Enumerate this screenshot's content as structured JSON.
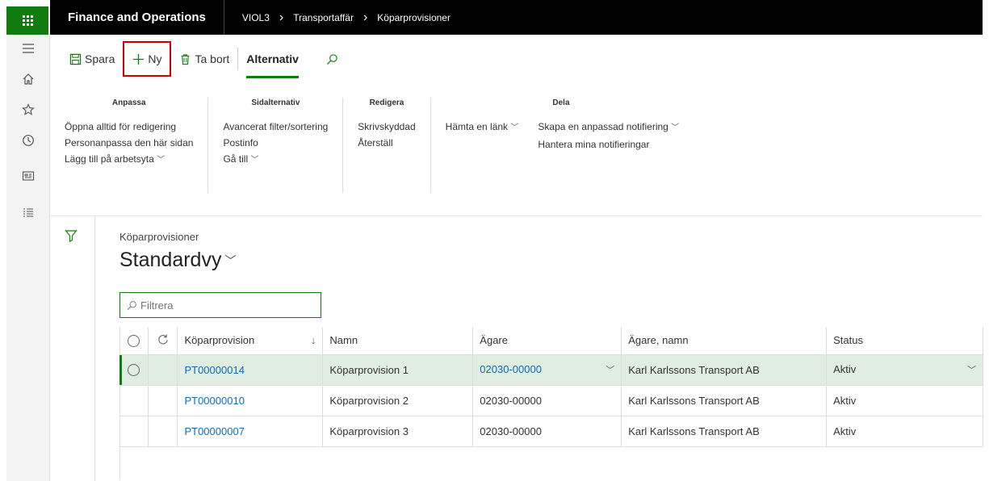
{
  "header": {
    "app_title": "Finance and Operations",
    "breadcrumbs": [
      "VIOL3",
      "Transportaffär",
      "Köparprovisioner"
    ]
  },
  "toolbar": {
    "save_label": "Spara",
    "new_label": "Ny",
    "delete_label": "Ta bort",
    "options_tab": "Alternativ"
  },
  "ribbon": {
    "groups": [
      {
        "title": "Anpassa",
        "items": [
          "Öppna alltid för redigering",
          "Personanpassa den här sidan",
          "Lägg till på arbetsyta"
        ]
      },
      {
        "title": "Sidalternativ",
        "items": [
          "Avancerat filter/sortering",
          "Postinfo",
          "Gå till"
        ]
      },
      {
        "title": "Redigera",
        "items": [
          "Skrivskyddad",
          "Återställ"
        ]
      },
      {
        "title": "",
        "items": [
          "Hämta en länk"
        ]
      },
      {
        "title": "Dela",
        "items": [
          "Skapa en anpassad notifiering",
          "Hantera mina notifieringar"
        ]
      }
    ]
  },
  "page": {
    "subtitle": "Köparprovisioner",
    "view_title": "Standardvy",
    "filter_placeholder": "Filtrera"
  },
  "grid": {
    "columns": [
      "Köparprovision",
      "Namn",
      "Ägare",
      "Ägare, namn",
      "Status"
    ],
    "rows": [
      {
        "id": "PT00000014",
        "name": "Köparprovision 1",
        "owner": "02030-00000",
        "owner_name": "Karl Karlssons Transport AB",
        "status": "Aktiv"
      },
      {
        "id": "PT00000010",
        "name": "Köparprovision 2",
        "owner": "02030-00000",
        "owner_name": "Karl Karlssons Transport AB",
        "status": "Aktiv"
      },
      {
        "id": "PT00000007",
        "name": "Köparprovision 3",
        "owner": "02030-00000",
        "owner_name": "Karl Karlssons Transport AB",
        "status": "Aktiv"
      }
    ]
  },
  "colors": {
    "accent": "#107c10",
    "link": "#0f6cbd",
    "highlight": "#c00000",
    "selected_row": "#dfeee0"
  }
}
